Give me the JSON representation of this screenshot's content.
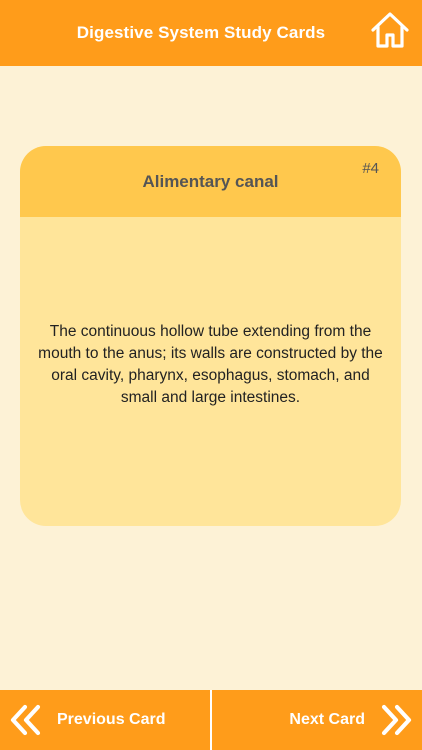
{
  "header": {
    "title": "Digestive System Study Cards",
    "home_icon": "home-icon"
  },
  "card": {
    "number": "#4",
    "title": "Alimentary canal",
    "definition": "The continuous hollow tube extending from the mouth to the anus; its walls are constructed by the oral cavity, pharynx, esophagus, stomach, and small and large intestines."
  },
  "footer": {
    "previous_label": "Previous Card",
    "next_label": "Next Card",
    "previous_icon": "double-chevron-left-icon",
    "next_icon": "double-chevron-right-icon"
  },
  "colors": {
    "accent_orange": "#ff9c1a",
    "background": "#fdf2d6",
    "card_header": "#ffc84d",
    "card_body": "#ffe59a"
  }
}
